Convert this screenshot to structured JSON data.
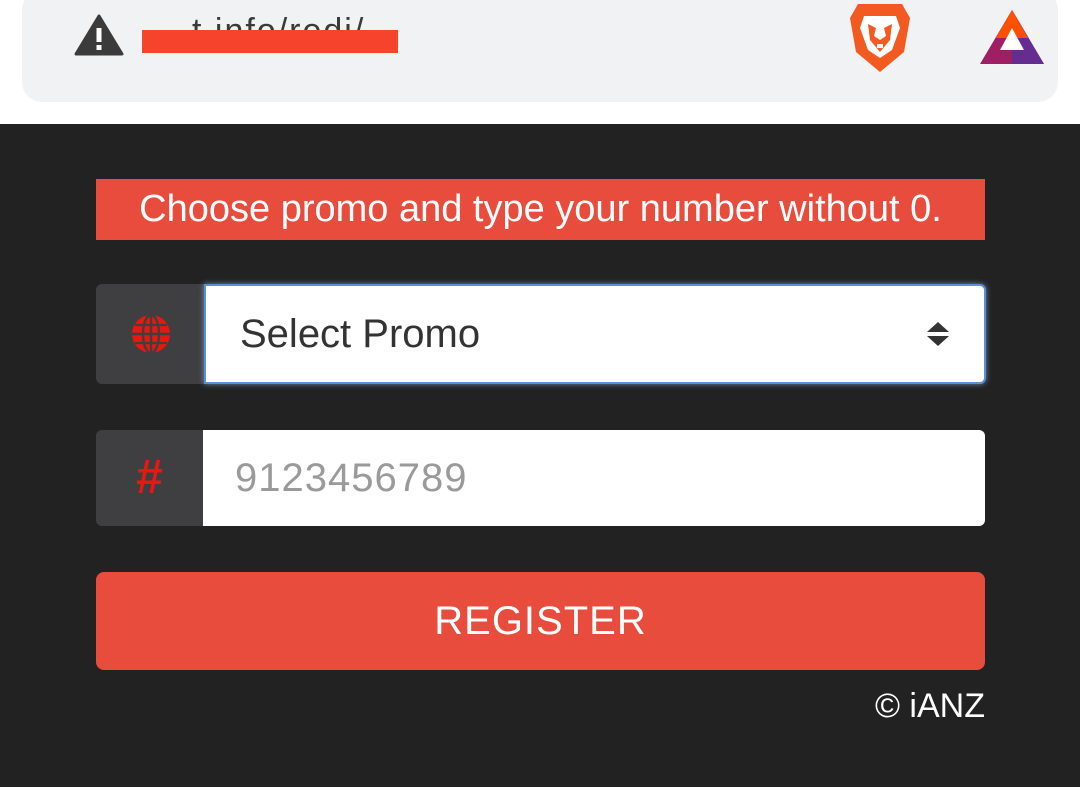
{
  "browser": {
    "security_icon": "warning-triangle-icon",
    "url": "t.info/redi/",
    "brave_icon": "brave-lion-icon",
    "rewards_icon": "bat-triangle-icon"
  },
  "form": {
    "notice": "Choose promo and type your number without 0.",
    "promo_icon": "globe-icon",
    "promo_select": {
      "selected": "Select Promo"
    },
    "number_icon": "#",
    "number_input": {
      "value": "",
      "placeholder": "9123456789"
    },
    "register_label": "REGISTER",
    "copyright": "© iANZ"
  },
  "colors": {
    "accent": "#e74c3c",
    "page_background": "#222222",
    "addon_background": "#3f3f41",
    "icon_red": "#e8170f",
    "redaction": "#f5442b"
  }
}
